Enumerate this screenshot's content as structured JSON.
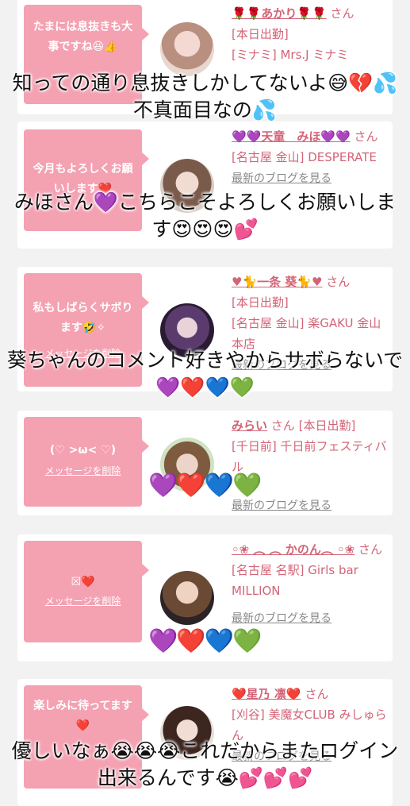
{
  "delete_label": "メッセージを削除",
  "blog_label": "最新のブログを見る",
  "cards": [
    {
      "message": "たまには息抜きも大事ですね😆👍",
      "name": "🌹🌹あかり🌹🌹",
      "san": "さん",
      "status": "[本日出勤]",
      "shop": "[ミナミ] Mrs.J ミナミ"
    },
    {
      "message": "今月もよろしくお願いします❤️",
      "name": "💜💜天童　みほ💜💜",
      "san": "さん",
      "status": "",
      "shop": "[名古屋 金山] DESPERATE"
    },
    {
      "message": "私もしばらくサボります🤣✧",
      "name": "♥🐈一条 葵🐈♥",
      "san": "さん",
      "status": "[本日出勤]",
      "shop": "[名古屋 金山] 楽GAKU 金山本店"
    },
    {
      "message": "(♡ >ω< ♡)",
      "name": "みらい",
      "san": "さん",
      "status": "[本日出勤]",
      "shop": "[千日前] 千日前フェスティバル"
    },
    {
      "message": "☒❤️",
      "name": "◦❀ ︵ ︵ かのん︵ ◦❀",
      "san": "さん",
      "status": "",
      "shop": "[名古屋 名駅] Girls bar MILLION"
    },
    {
      "message": "楽しみに待ってます❤️",
      "name": "❤️星乃 凛❤️",
      "san": "さん",
      "status": "",
      "shop": "[刈谷] 美魔女CLUB みしゅらん"
    }
  ],
  "overlays": [
    "知っての通り息抜きしかしてないよ😅💔💦不真面目なの💦",
    "みほさん💜こちらこそよろしくお願いします😍😍😍💕",
    "葵ちゃんのコメント好きやからサボらないで💜❤️💙💚",
    "優しいなぁ😭😭😭これだからまたログイン出来るんです😭💕💕💕"
  ],
  "heart_rows": [
    "💜❤️💙💚",
    "💜❤️💙💚"
  ],
  "colors": {
    "bubble": "#f4a1b2",
    "name": "#d36477",
    "background": "#f2f2f2"
  }
}
